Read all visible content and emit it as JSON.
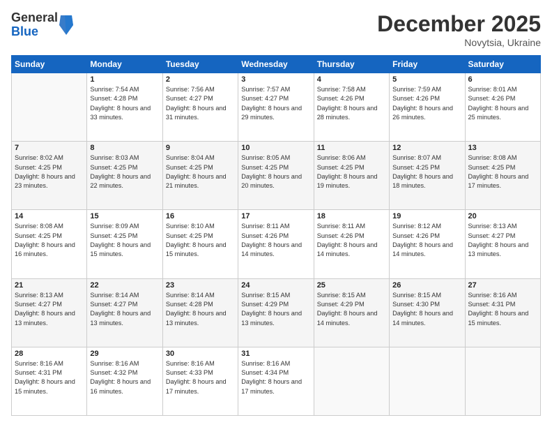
{
  "header": {
    "logo_general": "General",
    "logo_blue": "Blue",
    "title": "December 2025",
    "location": "Novytsia, Ukraine"
  },
  "calendar": {
    "days_of_week": [
      "Sunday",
      "Monday",
      "Tuesday",
      "Wednesday",
      "Thursday",
      "Friday",
      "Saturday"
    ],
    "weeks": [
      [
        {
          "day": "",
          "sunrise": "",
          "sunset": "",
          "daylight": ""
        },
        {
          "day": "1",
          "sunrise": "Sunrise: 7:54 AM",
          "sunset": "Sunset: 4:28 PM",
          "daylight": "Daylight: 8 hours and 33 minutes."
        },
        {
          "day": "2",
          "sunrise": "Sunrise: 7:56 AM",
          "sunset": "Sunset: 4:27 PM",
          "daylight": "Daylight: 8 hours and 31 minutes."
        },
        {
          "day": "3",
          "sunrise": "Sunrise: 7:57 AM",
          "sunset": "Sunset: 4:27 PM",
          "daylight": "Daylight: 8 hours and 29 minutes."
        },
        {
          "day": "4",
          "sunrise": "Sunrise: 7:58 AM",
          "sunset": "Sunset: 4:26 PM",
          "daylight": "Daylight: 8 hours and 28 minutes."
        },
        {
          "day": "5",
          "sunrise": "Sunrise: 7:59 AM",
          "sunset": "Sunset: 4:26 PM",
          "daylight": "Daylight: 8 hours and 26 minutes."
        },
        {
          "day": "6",
          "sunrise": "Sunrise: 8:01 AM",
          "sunset": "Sunset: 4:26 PM",
          "daylight": "Daylight: 8 hours and 25 minutes."
        }
      ],
      [
        {
          "day": "7",
          "sunrise": "Sunrise: 8:02 AM",
          "sunset": "Sunset: 4:25 PM",
          "daylight": "Daylight: 8 hours and 23 minutes."
        },
        {
          "day": "8",
          "sunrise": "Sunrise: 8:03 AM",
          "sunset": "Sunset: 4:25 PM",
          "daylight": "Daylight: 8 hours and 22 minutes."
        },
        {
          "day": "9",
          "sunrise": "Sunrise: 8:04 AM",
          "sunset": "Sunset: 4:25 PM",
          "daylight": "Daylight: 8 hours and 21 minutes."
        },
        {
          "day": "10",
          "sunrise": "Sunrise: 8:05 AM",
          "sunset": "Sunset: 4:25 PM",
          "daylight": "Daylight: 8 hours and 20 minutes."
        },
        {
          "day": "11",
          "sunrise": "Sunrise: 8:06 AM",
          "sunset": "Sunset: 4:25 PM",
          "daylight": "Daylight: 8 hours and 19 minutes."
        },
        {
          "day": "12",
          "sunrise": "Sunrise: 8:07 AM",
          "sunset": "Sunset: 4:25 PM",
          "daylight": "Daylight: 8 hours and 18 minutes."
        },
        {
          "day": "13",
          "sunrise": "Sunrise: 8:08 AM",
          "sunset": "Sunset: 4:25 PM",
          "daylight": "Daylight: 8 hours and 17 minutes."
        }
      ],
      [
        {
          "day": "14",
          "sunrise": "Sunrise: 8:08 AM",
          "sunset": "Sunset: 4:25 PM",
          "daylight": "Daylight: 8 hours and 16 minutes."
        },
        {
          "day": "15",
          "sunrise": "Sunrise: 8:09 AM",
          "sunset": "Sunset: 4:25 PM",
          "daylight": "Daylight: 8 hours and 15 minutes."
        },
        {
          "day": "16",
          "sunrise": "Sunrise: 8:10 AM",
          "sunset": "Sunset: 4:25 PM",
          "daylight": "Daylight: 8 hours and 15 minutes."
        },
        {
          "day": "17",
          "sunrise": "Sunrise: 8:11 AM",
          "sunset": "Sunset: 4:26 PM",
          "daylight": "Daylight: 8 hours and 14 minutes."
        },
        {
          "day": "18",
          "sunrise": "Sunrise: 8:11 AM",
          "sunset": "Sunset: 4:26 PM",
          "daylight": "Daylight: 8 hours and 14 minutes."
        },
        {
          "day": "19",
          "sunrise": "Sunrise: 8:12 AM",
          "sunset": "Sunset: 4:26 PM",
          "daylight": "Daylight: 8 hours and 14 minutes."
        },
        {
          "day": "20",
          "sunrise": "Sunrise: 8:13 AM",
          "sunset": "Sunset: 4:27 PM",
          "daylight": "Daylight: 8 hours and 13 minutes."
        }
      ],
      [
        {
          "day": "21",
          "sunrise": "Sunrise: 8:13 AM",
          "sunset": "Sunset: 4:27 PM",
          "daylight": "Daylight: 8 hours and 13 minutes."
        },
        {
          "day": "22",
          "sunrise": "Sunrise: 8:14 AM",
          "sunset": "Sunset: 4:27 PM",
          "daylight": "Daylight: 8 hours and 13 minutes."
        },
        {
          "day": "23",
          "sunrise": "Sunrise: 8:14 AM",
          "sunset": "Sunset: 4:28 PM",
          "daylight": "Daylight: 8 hours and 13 minutes."
        },
        {
          "day": "24",
          "sunrise": "Sunrise: 8:15 AM",
          "sunset": "Sunset: 4:29 PM",
          "daylight": "Daylight: 8 hours and 13 minutes."
        },
        {
          "day": "25",
          "sunrise": "Sunrise: 8:15 AM",
          "sunset": "Sunset: 4:29 PM",
          "daylight": "Daylight: 8 hours and 14 minutes."
        },
        {
          "day": "26",
          "sunrise": "Sunrise: 8:15 AM",
          "sunset": "Sunset: 4:30 PM",
          "daylight": "Daylight: 8 hours and 14 minutes."
        },
        {
          "day": "27",
          "sunrise": "Sunrise: 8:16 AM",
          "sunset": "Sunset: 4:31 PM",
          "daylight": "Daylight: 8 hours and 15 minutes."
        }
      ],
      [
        {
          "day": "28",
          "sunrise": "Sunrise: 8:16 AM",
          "sunset": "Sunset: 4:31 PM",
          "daylight": "Daylight: 8 hours and 15 minutes."
        },
        {
          "day": "29",
          "sunrise": "Sunrise: 8:16 AM",
          "sunset": "Sunset: 4:32 PM",
          "daylight": "Daylight: 8 hours and 16 minutes."
        },
        {
          "day": "30",
          "sunrise": "Sunrise: 8:16 AM",
          "sunset": "Sunset: 4:33 PM",
          "daylight": "Daylight: 8 hours and 17 minutes."
        },
        {
          "day": "31",
          "sunrise": "Sunrise: 8:16 AM",
          "sunset": "Sunset: 4:34 PM",
          "daylight": "Daylight: 8 hours and 17 minutes."
        },
        {
          "day": "",
          "sunrise": "",
          "sunset": "",
          "daylight": ""
        },
        {
          "day": "",
          "sunrise": "",
          "sunset": "",
          "daylight": ""
        },
        {
          "day": "",
          "sunrise": "",
          "sunset": "",
          "daylight": ""
        }
      ]
    ]
  }
}
